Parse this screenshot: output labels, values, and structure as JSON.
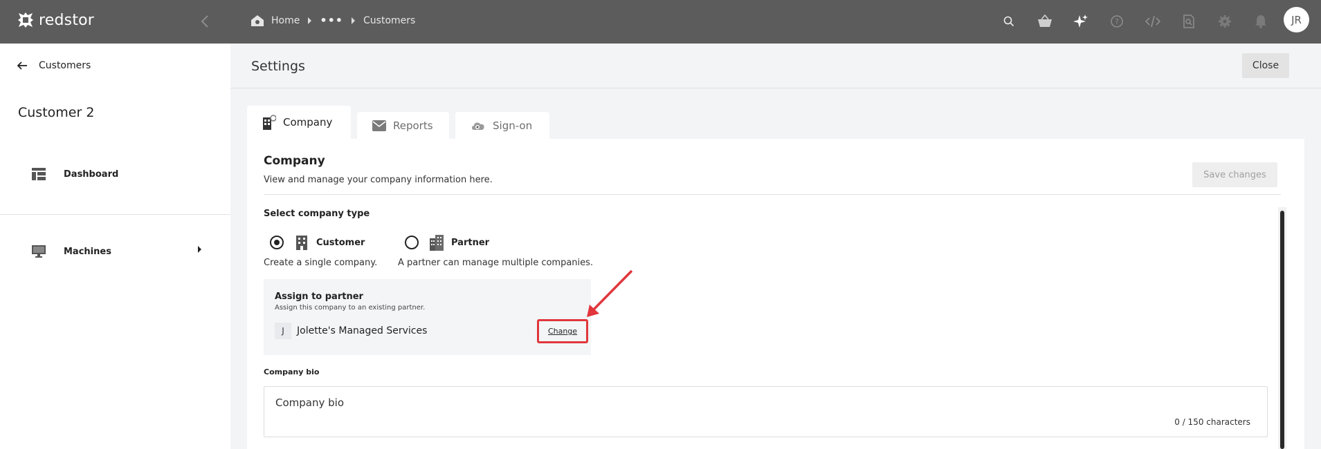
{
  "topbar": {
    "logo_text": "redstor",
    "breadcrumb": {
      "home": "Home",
      "ellipsis": "•••",
      "current": "Customers"
    },
    "icons": [
      "search-icon",
      "basket-icon",
      "sparkle-icon",
      "help-icon",
      "code-icon",
      "document-search-icon",
      "gear-icon",
      "bell-icon"
    ],
    "avatar_initials": "JR"
  },
  "sidebar": {
    "back_label": "Customers",
    "title": "Customer 2",
    "items": [
      {
        "label": "Dashboard",
        "icon": "dashboard-icon"
      },
      {
        "label": "Machines",
        "icon": "monitor-icon"
      }
    ]
  },
  "header": {
    "title": "Settings",
    "close_label": "Close"
  },
  "tabs": [
    {
      "label": "Company",
      "icon": "building-icon",
      "active": true
    },
    {
      "label": "Reports",
      "icon": "envelope-icon",
      "active": false
    },
    {
      "label": "Sign-on",
      "icon": "cloud-key-icon",
      "active": false
    }
  ],
  "company": {
    "title": "Company",
    "subtitle": "View and manage your company information here.",
    "save_label": "Save changes",
    "type_label": "Select company type",
    "options": [
      {
        "label": "Customer",
        "description": "Create a single company.",
        "selected": true
      },
      {
        "label": "Partner",
        "description": "A partner can manage multiple companies.",
        "selected": false
      }
    ],
    "assign": {
      "title": "Assign to partner",
      "subtitle": "Assign this company to an existing partner.",
      "partner_initial": "J",
      "partner_name": "Jolette's Managed Services",
      "change_label": "Change"
    },
    "bio": {
      "label": "Company bio",
      "placeholder": "Company bio",
      "counter": "0 / 150 characters"
    }
  },
  "colors": {
    "topbar": "#5c5c5c",
    "highlight": "#e0363c",
    "sidebar_bg": "#ffffff",
    "page_bg": "#f3f4f6"
  }
}
